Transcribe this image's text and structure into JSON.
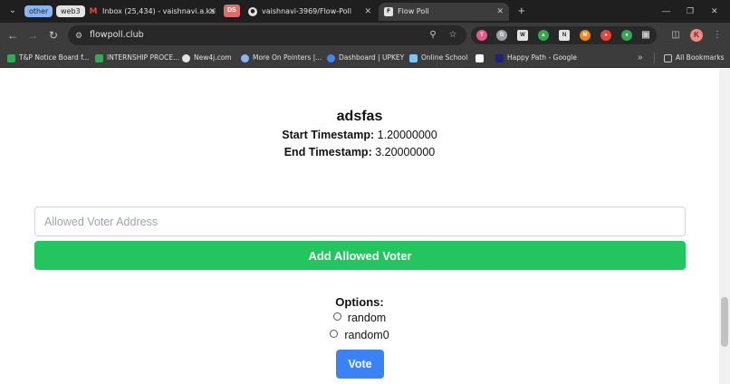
{
  "browser": {
    "tab_groups": [
      {
        "label": "other",
        "color": "#8ab4f8"
      },
      {
        "label": "web3",
        "color": "#e3e3e3"
      }
    ],
    "tabs": [
      {
        "title": "Inbox (25,434) - vaishnavi.a.kal",
        "icon": "gmail-icon"
      },
      {
        "title": "DS",
        "icon": "ds-badge"
      },
      {
        "title": "vaishnavi-3969/Flow-Poll",
        "icon": "github-icon"
      },
      {
        "title": "Flow Poll",
        "icon": "flow-icon",
        "active": true
      }
    ],
    "url": "flowpoll.club",
    "profile_initial": "K",
    "bookmarks": [
      {
        "label": "T&P Notice Board f...",
        "color": "#34a853"
      },
      {
        "label": "INTERNSHIP PROCE...",
        "color": "#34a853"
      },
      {
        "label": "New4j.com",
        "color": "#e3e3e3"
      },
      {
        "label": "More On Pointers |...",
        "color": "#8ab4f8"
      },
      {
        "label": "Dashboard | UPKEY",
        "color": "#4285f4"
      },
      {
        "label": "Online School",
        "color": "#7cc4f4"
      },
      {
        "label": "",
        "color": "#ffffff"
      },
      {
        "label": "Happy Path - Google",
        "color": "#1a237e"
      }
    ],
    "all_bookmarks_label": "All Bookmarks"
  },
  "poll": {
    "title": "adsfas",
    "start_label": "Start Timestamp:",
    "start_value": "1.20000000",
    "end_label": "End Timestamp:",
    "end_value": "3.20000000"
  },
  "voter": {
    "placeholder": "Allowed Voter Address",
    "value": "",
    "add_button_label": "Add Allowed Voter"
  },
  "options": {
    "label": "Options:",
    "items": [
      "random",
      "random0"
    ],
    "vote_button_label": "Vote"
  },
  "colors": {
    "add_button": "#22c55e",
    "vote_button": "#3b82f6"
  }
}
